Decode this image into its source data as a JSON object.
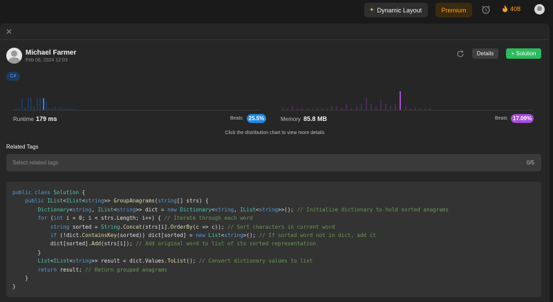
{
  "topbar": {
    "dynamic_layout": "Dynamic Layout",
    "premium": "Premium",
    "streak_count": "408"
  },
  "submission": {
    "author": "Michael Farmer",
    "date": "Feb 06, 2024 12:03",
    "details_label": "Details",
    "solution_label": "+ Solution",
    "language": "C#"
  },
  "stats": {
    "runtime_label": "Runtime",
    "runtime_value": "179 ms",
    "runtime_beats_label": "Beats",
    "runtime_beats": "25.5%",
    "memory_label": "Memory",
    "memory_value": "85.8 MB",
    "memory_beats_label": "Beats",
    "memory_beats": "17.09%",
    "hint": "Click the distribution chart to view more details"
  },
  "charts": {
    "runtime_bars": [
      0.05,
      0.1,
      0.55,
      0.1,
      0.6,
      0.55,
      0.2,
      0.55,
      0.55,
      0.55,
      0.4,
      0.1,
      0.1,
      0.15,
      0.05,
      0.1,
      0.05,
      0.05,
      0.05,
      0.05
    ],
    "runtime_highlight": 9,
    "memory_bars": [
      0.1,
      0.05,
      0.2,
      0.05,
      0.05,
      0.05,
      0.05,
      0.1,
      0.05,
      0.05,
      0.15,
      0.2,
      0.1,
      0.25,
      0.05,
      0.15,
      0.3,
      0.6,
      0.25,
      0.15,
      0.5,
      0.3,
      0.2,
      0.3,
      0.9,
      0.2,
      0.1,
      0.1,
      0.05,
      0.05,
      0.05
    ],
    "memory_highlight": 24,
    "colors": {
      "runtime": "#1e3a5f",
      "runtime_highlight": "#1e88e5",
      "memory": "#4a2a5a",
      "memory_highlight": "#a64bdb"
    }
  },
  "related_tags": {
    "title": "Related Tags",
    "placeholder": "Select related tags",
    "count": "0/5"
  },
  "code_lines": [
    [
      [
        "kw",
        "public "
      ],
      [
        "kw",
        "class "
      ],
      [
        "ty",
        "Solution"
      ],
      [
        "p",
        " {"
      ]
    ],
    [
      [
        "p",
        "    "
      ],
      [
        "kw",
        "public "
      ],
      [
        "ty",
        "IList"
      ],
      [
        "p",
        "<"
      ],
      [
        "ty",
        "IList"
      ],
      [
        "p",
        "<"
      ],
      [
        "kw",
        "string"
      ],
      [
        "p",
        ">> "
      ],
      [
        "fn",
        "GroupAnagrams"
      ],
      [
        "p",
        "("
      ],
      [
        "kw",
        "string"
      ],
      [
        "p",
        "[] strs) {"
      ]
    ],
    [
      [
        "p",
        "        "
      ],
      [
        "ty",
        "Dictionary"
      ],
      [
        "p",
        "<"
      ],
      [
        "kw",
        "string"
      ],
      [
        "p",
        ", "
      ],
      [
        "ty",
        "IList"
      ],
      [
        "p",
        "<"
      ],
      [
        "kw",
        "string"
      ],
      [
        "p",
        ">> dict = "
      ],
      [
        "kw",
        "new "
      ],
      [
        "ty",
        "Dictionary"
      ],
      [
        "p",
        "<"
      ],
      [
        "kw",
        "string"
      ],
      [
        "p",
        ", "
      ],
      [
        "ty",
        "IList"
      ],
      [
        "p",
        "<"
      ],
      [
        "kw",
        "string"
      ],
      [
        "p",
        ">>(); "
      ],
      [
        "cm",
        "// Initialize dictionary to hold sorted anagrams"
      ]
    ],
    [
      [
        "p",
        "        "
      ],
      [
        "kw",
        "for "
      ],
      [
        "p",
        "("
      ],
      [
        "kw",
        "int "
      ],
      [
        "p",
        "i = 0; i < strs.Length; i++) { "
      ],
      [
        "cm",
        "// Iterate through each word"
      ]
    ],
    [
      [
        "p",
        "            "
      ],
      [
        "kw",
        "string "
      ],
      [
        "p",
        "sorted = "
      ],
      [
        "ty",
        "String"
      ],
      [
        "p",
        "."
      ],
      [
        "fn",
        "Concat"
      ],
      [
        "p",
        "(strs[i]."
      ],
      [
        "fn",
        "OrderBy"
      ],
      [
        "p",
        "(c => c)); "
      ],
      [
        "cm",
        "// Sort characters in current word"
      ]
    ],
    [
      [
        "p",
        "            "
      ],
      [
        "kw",
        "if "
      ],
      [
        "p",
        "(!dict."
      ],
      [
        "fn",
        "ContainsKey"
      ],
      [
        "p",
        "(sorted)) dict[sorted] = "
      ],
      [
        "kw",
        "new "
      ],
      [
        "ty",
        "List"
      ],
      [
        "p",
        "<"
      ],
      [
        "kw",
        "string"
      ],
      [
        "p",
        ">(); "
      ],
      [
        "cm",
        "// If sorted word not in dict, add it"
      ]
    ],
    [
      [
        "p",
        "            dict[sorted]."
      ],
      [
        "fn",
        "Add"
      ],
      [
        "p",
        "(strs[i]); "
      ],
      [
        "cm",
        "// Add original word to list of its sorted representation"
      ]
    ],
    [
      [
        "p",
        "        }"
      ]
    ],
    [
      [
        "p",
        "        "
      ],
      [
        "ty",
        "List"
      ],
      [
        "p",
        "<"
      ],
      [
        "ty",
        "IList"
      ],
      [
        "p",
        "<"
      ],
      [
        "kw",
        "string"
      ],
      [
        "p",
        ">> result = dict.Values."
      ],
      [
        "fn",
        "ToList"
      ],
      [
        "p",
        "(); "
      ],
      [
        "cm",
        "// Convert dictionary values to list"
      ]
    ],
    [
      [
        "p",
        "        "
      ],
      [
        "kw",
        "return "
      ],
      [
        "p",
        "result; "
      ],
      [
        "cm",
        "// Return grouped anagrams"
      ]
    ],
    [
      [
        "p",
        "    }"
      ]
    ],
    [
      [
        "p",
        "}"
      ]
    ]
  ]
}
